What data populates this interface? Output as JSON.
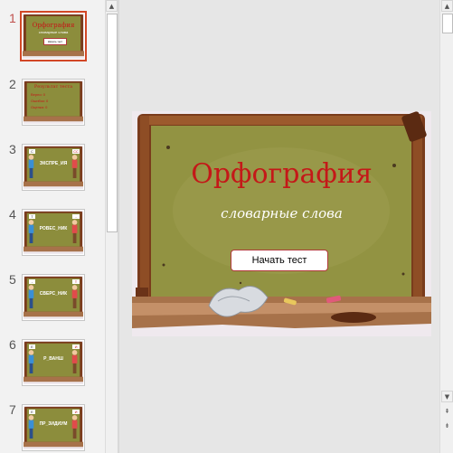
{
  "slides": [
    {
      "number": "1",
      "title": "Орфография",
      "subtitle": "словарные слова",
      "button": "Начать тест"
    },
    {
      "number": "2",
      "title": "Результат теста",
      "lines": [
        "Верно: 0",
        "Ошибок: 0",
        "Оценка: 0"
      ]
    },
    {
      "number": "3",
      "word": "ЭКСПРЕ_ИЯ",
      "letters": [
        "С",
        "СС"
      ]
    },
    {
      "number": "4",
      "word": "РОВЕС_НИК",
      "letters": [
        "Т",
        "-"
      ]
    },
    {
      "number": "5",
      "word": "СВЕРС_НИК",
      "letters": [
        "-",
        "Т"
      ]
    },
    {
      "number": "6",
      "word": "Р_ВАНШ",
      "letters": [
        "Е",
        "И"
      ]
    },
    {
      "number": "7",
      "word": "ПР_ЗИДИУМ",
      "letters": [
        "Е",
        "И"
      ]
    }
  ],
  "main_slide": {
    "title": "Орфография",
    "subtitle": "словарные слова",
    "button_label": "Начать тест"
  },
  "scrollbar": {
    "up_glyph": "▲",
    "down_glyph": "▼",
    "prev_glyph": "⇞",
    "next_glyph": "⇟"
  }
}
